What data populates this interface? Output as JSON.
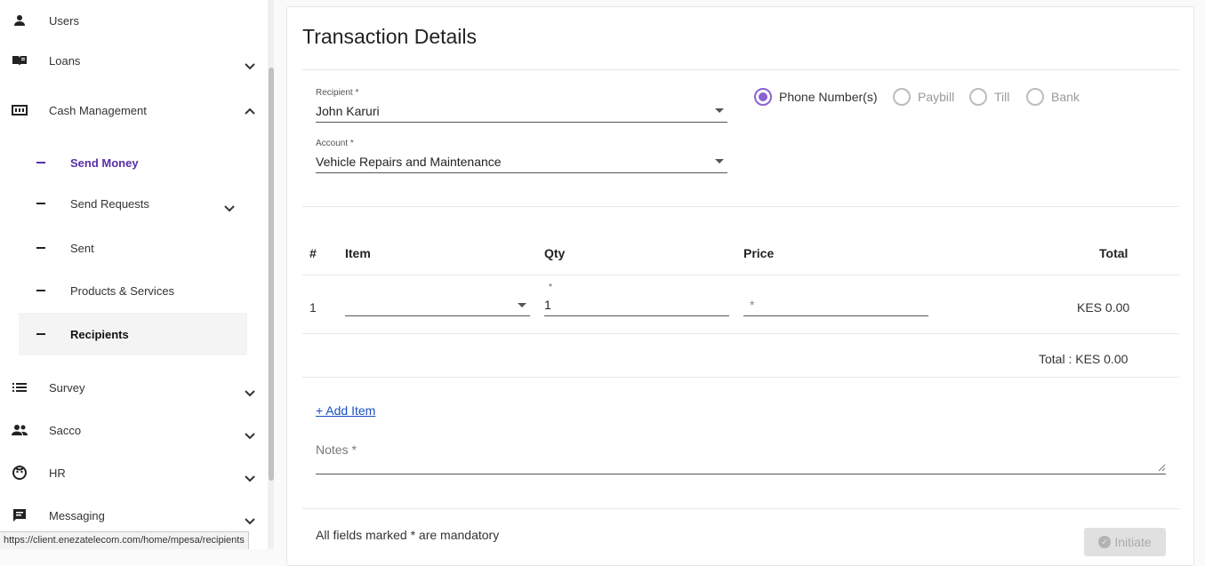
{
  "sidebar": {
    "items": [
      {
        "label": "Users",
        "icon": "person-icon"
      },
      {
        "label": "Loans",
        "icon": "book-icon"
      },
      {
        "label": "Cash Management",
        "icon": "cash-icon"
      },
      {
        "label": "Survey",
        "icon": "list-icon"
      },
      {
        "label": "Sacco",
        "icon": "group-icon"
      },
      {
        "label": "HR",
        "icon": "face-icon"
      },
      {
        "label": "Messaging",
        "icon": "message-icon"
      }
    ],
    "subitems": [
      {
        "label": "Send Money"
      },
      {
        "label": "Send Requests"
      },
      {
        "label": "Sent"
      },
      {
        "label": "Products & Services"
      },
      {
        "label": "Recipients"
      }
    ],
    "accent_color": "#5b2ea6"
  },
  "status_bar": {
    "url": "https://client.enezatelecom.com/home/mpesa/recipients"
  },
  "main": {
    "title": "Transaction Details",
    "recipient": {
      "label": "Recipient *",
      "value": "John Karuri"
    },
    "account": {
      "label": "Account *",
      "value": "Vehicle Repairs and Maintenance"
    },
    "payment_types": [
      {
        "label": "Phone Number(s)",
        "selected": true
      },
      {
        "label": "Paybill",
        "selected": false
      },
      {
        "label": "Till",
        "selected": false
      },
      {
        "label": "Bank",
        "selected": false
      }
    ],
    "table": {
      "headers": [
        "#",
        "Item",
        "Qty",
        "Price",
        "Total"
      ],
      "rows": [
        {
          "index": "1",
          "item": "",
          "qty_mark": "*",
          "qty": "1",
          "price_placeholder": "*",
          "total": "KES 0.00"
        }
      ],
      "grand_total": "Total : KES 0.00"
    },
    "add_item_label": "+ Add Item",
    "notes_label": "Notes *",
    "mandatory_note": "All fields marked * are mandatory",
    "initiate_label": "Initiate",
    "radio_color": "#8a63d2",
    "link_color": "#1a4fc4"
  }
}
